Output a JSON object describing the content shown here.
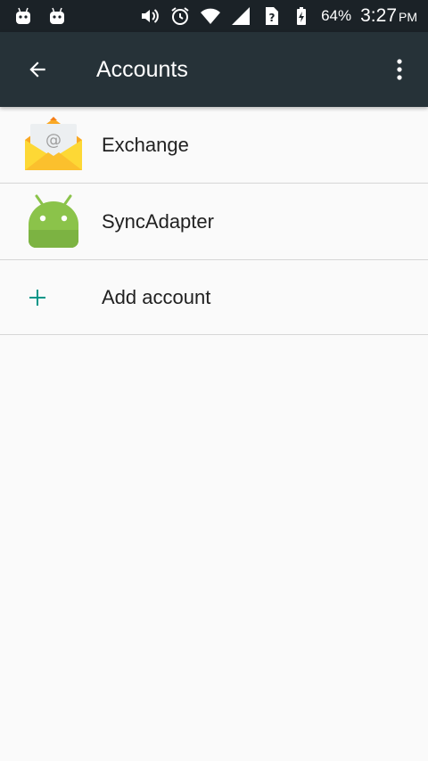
{
  "status_bar": {
    "notification_icons": [
      "android-robot-icon",
      "android-robot-icon"
    ],
    "battery_percent": "64%",
    "time": "3:27",
    "ampm": "PM"
  },
  "app_bar": {
    "title": "Accounts"
  },
  "accounts": [
    {
      "label": "Exchange",
      "icon": "exchange-mail-icon"
    },
    {
      "label": "SyncAdapter",
      "icon": "android-robot-icon"
    }
  ],
  "add_account": {
    "label": "Add account",
    "icon": "plus-icon"
  },
  "colors": {
    "status_bar": "#1b2227",
    "app_bar": "#263238",
    "background": "#fafafa",
    "accent": "#009688",
    "android_green": "#8bc34a"
  }
}
